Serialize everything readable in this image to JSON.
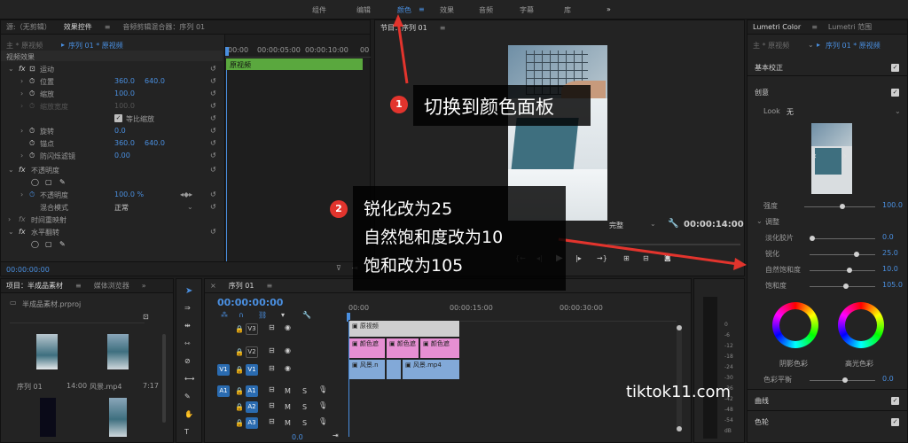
{
  "workspaces": [
    {
      "label": "组件",
      "active": false
    },
    {
      "label": "编辑",
      "active": false
    },
    {
      "label": "颜色",
      "active": true
    },
    {
      "label": "效果",
      "active": false
    },
    {
      "label": "音频",
      "active": false
    },
    {
      "label": "字幕",
      "active": false
    },
    {
      "label": "库",
      "active": false
    }
  ],
  "effect_controls": {
    "source_tab": "源:（无剪辑）",
    "tab": "效果控件",
    "audio_mixer_tab": "音频剪辑混合器：序列 01",
    "clip_path": "主 * 原视频",
    "sequence_clip": "序列 01 * 原视频",
    "section_video": "视频效果",
    "motion": "运动",
    "position": "位置",
    "position_x": "360.0",
    "position_y": "640.0",
    "scale": "缩放",
    "scale_val": "100.0",
    "scale_width": "缩放宽度",
    "scale_width_val": "100.0",
    "uniform_scale": "等比缩放",
    "rotation": "旋转",
    "rotation_val": "0.0",
    "anchor": "锚点",
    "anchor_x": "360.0",
    "anchor_y": "640.0",
    "anti_flicker": "防闪烁滤镜",
    "anti_flicker_val": "0.00",
    "opacity_section": "不透明度",
    "opacity": "不透明度",
    "opacity_val": "100.0 %",
    "blend_mode": "混合模式",
    "blend_val": "正常",
    "time_remap": "时间重映射",
    "flip": "水平翻转",
    "timecode": "00:00:00:00",
    "ruler": [
      "00:00",
      "00:00:05:00",
      "00:00:10:00",
      "00"
    ],
    "clip_label": "原视频"
  },
  "program": {
    "tab": "节目：序列 01",
    "fit": "完整",
    "timecode": "00:00:14:00"
  },
  "project": {
    "tab": "项目：半成品素材",
    "media_tab": "媒体浏览器",
    "file": "半成品素材.prproj",
    "items": [
      {
        "name": "序列 01",
        "duration": "14:00"
      },
      {
        "name": "风景.mp4",
        "duration": "7:17"
      }
    ]
  },
  "timeline": {
    "tab": "序列 01",
    "timecode": "00:00:00:00",
    "ruler": [
      "00:00",
      "00:00:15:00",
      "00:00:30:00"
    ],
    "tracks": [
      "V3",
      "V2",
      "V1",
      "A1",
      "A2",
      "A3"
    ],
    "source_v": "V1",
    "source_a": "A1",
    "mute": "M",
    "solo": "S",
    "clips": {
      "v3": "原视频",
      "v2_a": "颜色遮",
      "v2_b": "颜色遮",
      "v2_c": "颜色遮",
      "v1_a": "风景.n",
      "v1_b": "风景.mp4"
    },
    "volume": "0.0",
    "meter_ticks": [
      "0",
      "-6",
      "-12",
      "-18",
      "-24",
      "-30",
      "-36",
      "-42",
      "-48",
      "-54",
      "dB"
    ]
  },
  "lumetri": {
    "tab": "Lumetri Color",
    "scope_tab": "Lumetri 范围",
    "clip_path": "主 * 原视频",
    "sequence_clip": "序列 01 * 原视频",
    "basic": "基本校正",
    "creative": "创意",
    "look_label": "Look",
    "look_val": "无",
    "intensity": "强度",
    "intensity_val": "100.0",
    "adjust": "调整",
    "faded": "淡化胶片",
    "faded_val": "0.0",
    "sharpen": "锐化",
    "sharpen_val": "25.0",
    "vibrance": "自然饱和度",
    "vibrance_val": "10.0",
    "saturation": "饱和度",
    "saturation_val": "105.0",
    "shadow_tint": "阴影色彩",
    "highlight_tint": "高光色彩",
    "color_balance": "色彩平衡",
    "color_balance_val": "0.0",
    "curves": "曲线",
    "color_wheels": "色轮"
  },
  "annotations": {
    "step1_num": "1",
    "step1": "切换到颜色面板",
    "step2_num": "2",
    "step2_lines": [
      "锐化改为25",
      "自然饱和度改为10",
      "饱和改为105"
    ]
  },
  "watermark": "tiktok11.com",
  "colors": {
    "accent": "#4a8fe0",
    "badge": "#e2342d",
    "clip_green": "#5aa83e"
  }
}
